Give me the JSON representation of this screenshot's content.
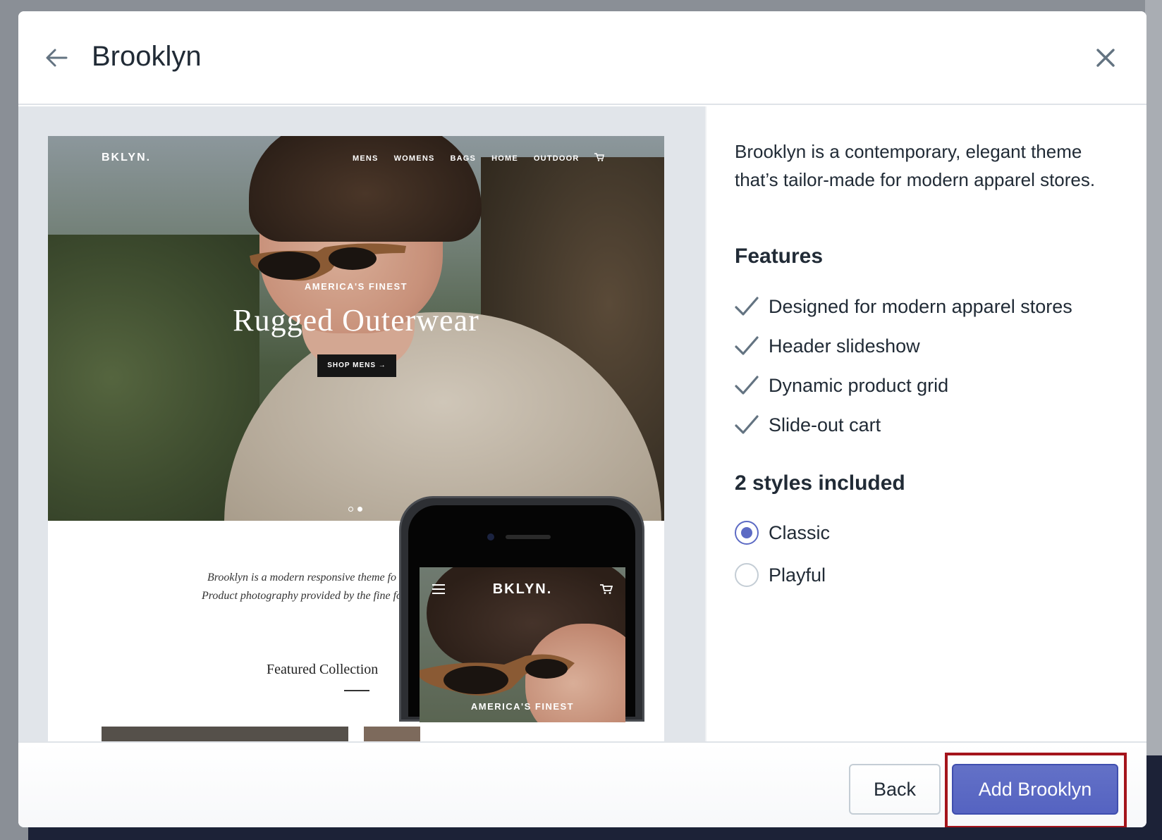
{
  "modal": {
    "title": "Brooklyn"
  },
  "preview": {
    "desktop": {
      "brand": "BKLYN.",
      "nav": [
        "MENS",
        "WOMENS",
        "BAGS",
        "HOME",
        "OUTDOOR"
      ],
      "eyebrow": "AMERICA'S FINEST",
      "headline": "Rugged Outerwear",
      "cta": "SHOP MENS →",
      "description_line1": "Brooklyn is a modern responsive theme fo",
      "description_line2": "Product photography provided by the fine fo",
      "featured_heading": "Featured Collection"
    },
    "mobile": {
      "brand": "BKLYN.",
      "eyebrow": "AMERICA'S FINEST"
    }
  },
  "info": {
    "description": "Brooklyn is a contemporary, elegant theme that’s tailor-made for modern apparel stores.",
    "features_title": "Features",
    "features": [
      "Designed for modern apparel stores",
      "Header slideshow",
      "Dynamic product grid",
      "Slide-out cart"
    ],
    "styles_title": "2 styles included",
    "styles": [
      {
        "label": "Classic",
        "selected": true
      },
      {
        "label": "Playful",
        "selected": false
      }
    ]
  },
  "footer": {
    "back_label": "Back",
    "add_label": "Add Brooklyn"
  },
  "colors": {
    "primary": "#5c6ac4",
    "highlight": "#a4141b",
    "text": "#212b36"
  },
  "icons": {
    "back": "arrow-left-icon",
    "close": "close-icon",
    "check": "check-icon"
  }
}
